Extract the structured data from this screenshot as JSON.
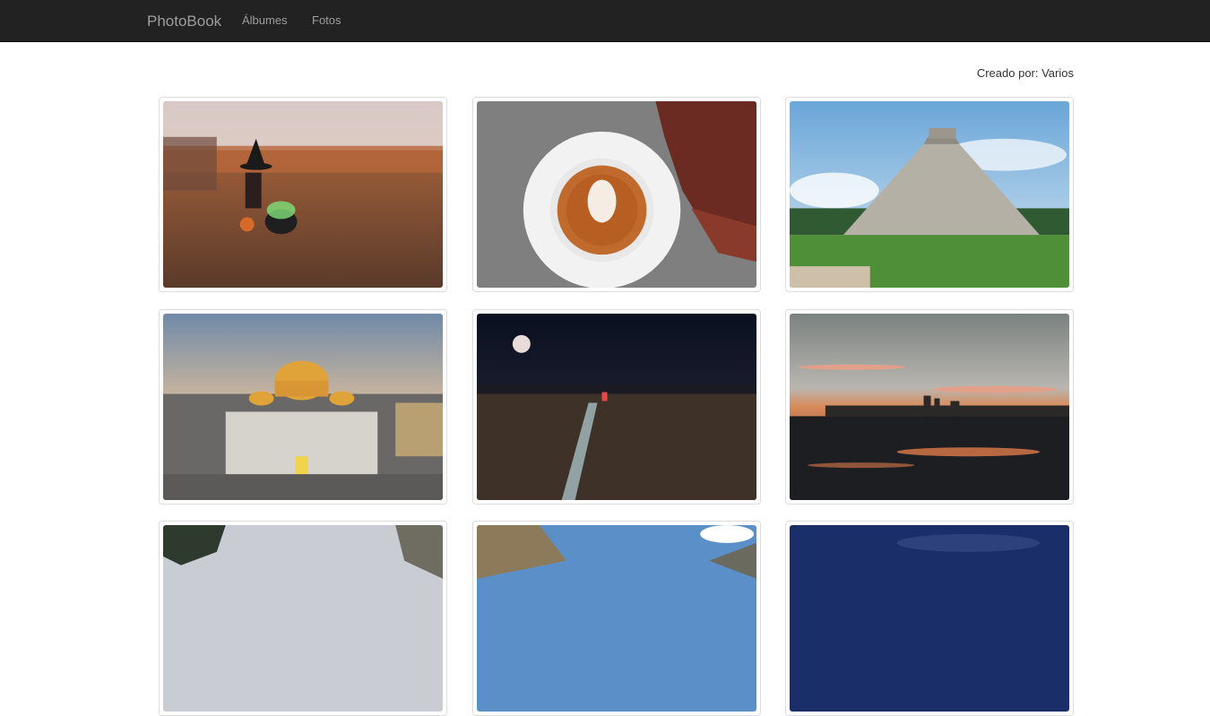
{
  "navbar": {
    "brand": "PhotoBook",
    "links": [
      {
        "label": "Álbumes"
      },
      {
        "label": "Fotos"
      }
    ]
  },
  "credit": "Creado por: Varios",
  "photos": [
    {
      "subject": "witch-girl-field"
    },
    {
      "subject": "latte-coffee-leaves"
    },
    {
      "subject": "chichen-itza-pyramid"
    },
    {
      "subject": "palacio-bellas-artes"
    },
    {
      "subject": "city-night-moon"
    },
    {
      "subject": "city-skyline-sunset"
    },
    {
      "subject": "cliffs-trees"
    },
    {
      "subject": "mountains-lake"
    },
    {
      "subject": "night-sky-stars"
    }
  ],
  "colors": {
    "navbar_bg": "#222222",
    "nav_text": "#9d9d9d",
    "thumb_border": "#dddddd"
  }
}
